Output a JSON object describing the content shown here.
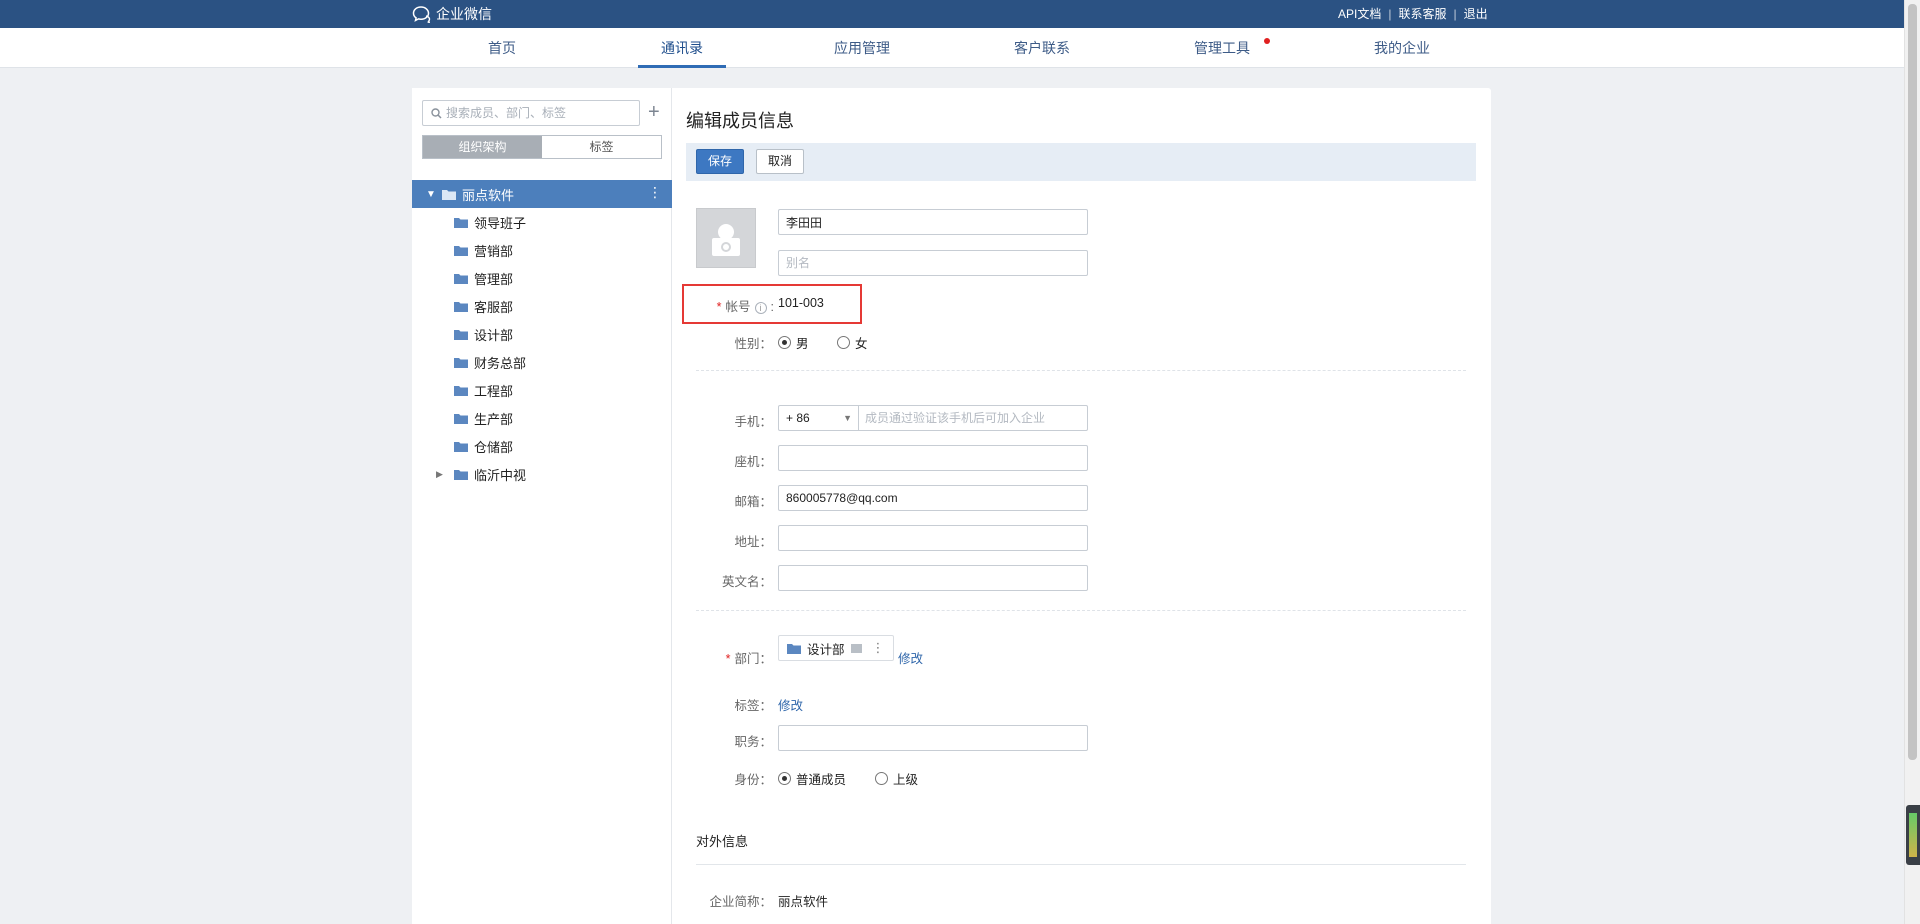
{
  "topbar": {
    "brand": "企业微信",
    "links": [
      "API文档",
      "联系客服",
      "退出"
    ]
  },
  "nav": {
    "items": [
      {
        "label": "首页"
      },
      {
        "label": "通讯录",
        "active": true
      },
      {
        "label": "应用管理"
      },
      {
        "label": "客户联系"
      },
      {
        "label": "管理工具",
        "badge": true
      },
      {
        "label": "我的企业"
      }
    ]
  },
  "sidebar": {
    "search_placeholder": "搜索成员、部门、标签",
    "tabs": [
      "组织架构",
      "标签"
    ],
    "root": "丽点软件",
    "departments": [
      "领导班子",
      "营销部",
      "管理部",
      "客服部",
      "设计部",
      "财务总部",
      "工程部",
      "生产部",
      "仓储部"
    ],
    "collapsed_department": "临沂中视"
  },
  "form": {
    "title": "编辑成员信息",
    "save_label": "保存",
    "cancel_label": "取消",
    "name_value": "李田田",
    "alias_placeholder": "别名",
    "account_label": "帐号",
    "account_value": "101-003",
    "gender_label": "性别：",
    "gender_options": [
      "男",
      "女"
    ],
    "phone_label": "手机：",
    "phone_code": "+ 86",
    "phone_placeholder": "成员通过验证该手机后可加入企业",
    "landline_label": "座机：",
    "email_label": "邮箱：",
    "email_value": "860005778@qq.com",
    "address_label": "地址：",
    "english_name_label": "英文名：",
    "department_label": "部门：",
    "department_value": "设计部",
    "modify_label": "修改",
    "tag_label": "标签：",
    "position_label": "职务：",
    "identity_label": "身份：",
    "identity_options": [
      "普通成员",
      "上级"
    ],
    "external_title": "对外信息",
    "company_short_label": "企业简称：",
    "company_short_value": "丽点软件"
  },
  "colors": {
    "topbar": "#2b5283",
    "accent": "#3d78c2",
    "highlight": "#e53935"
  }
}
